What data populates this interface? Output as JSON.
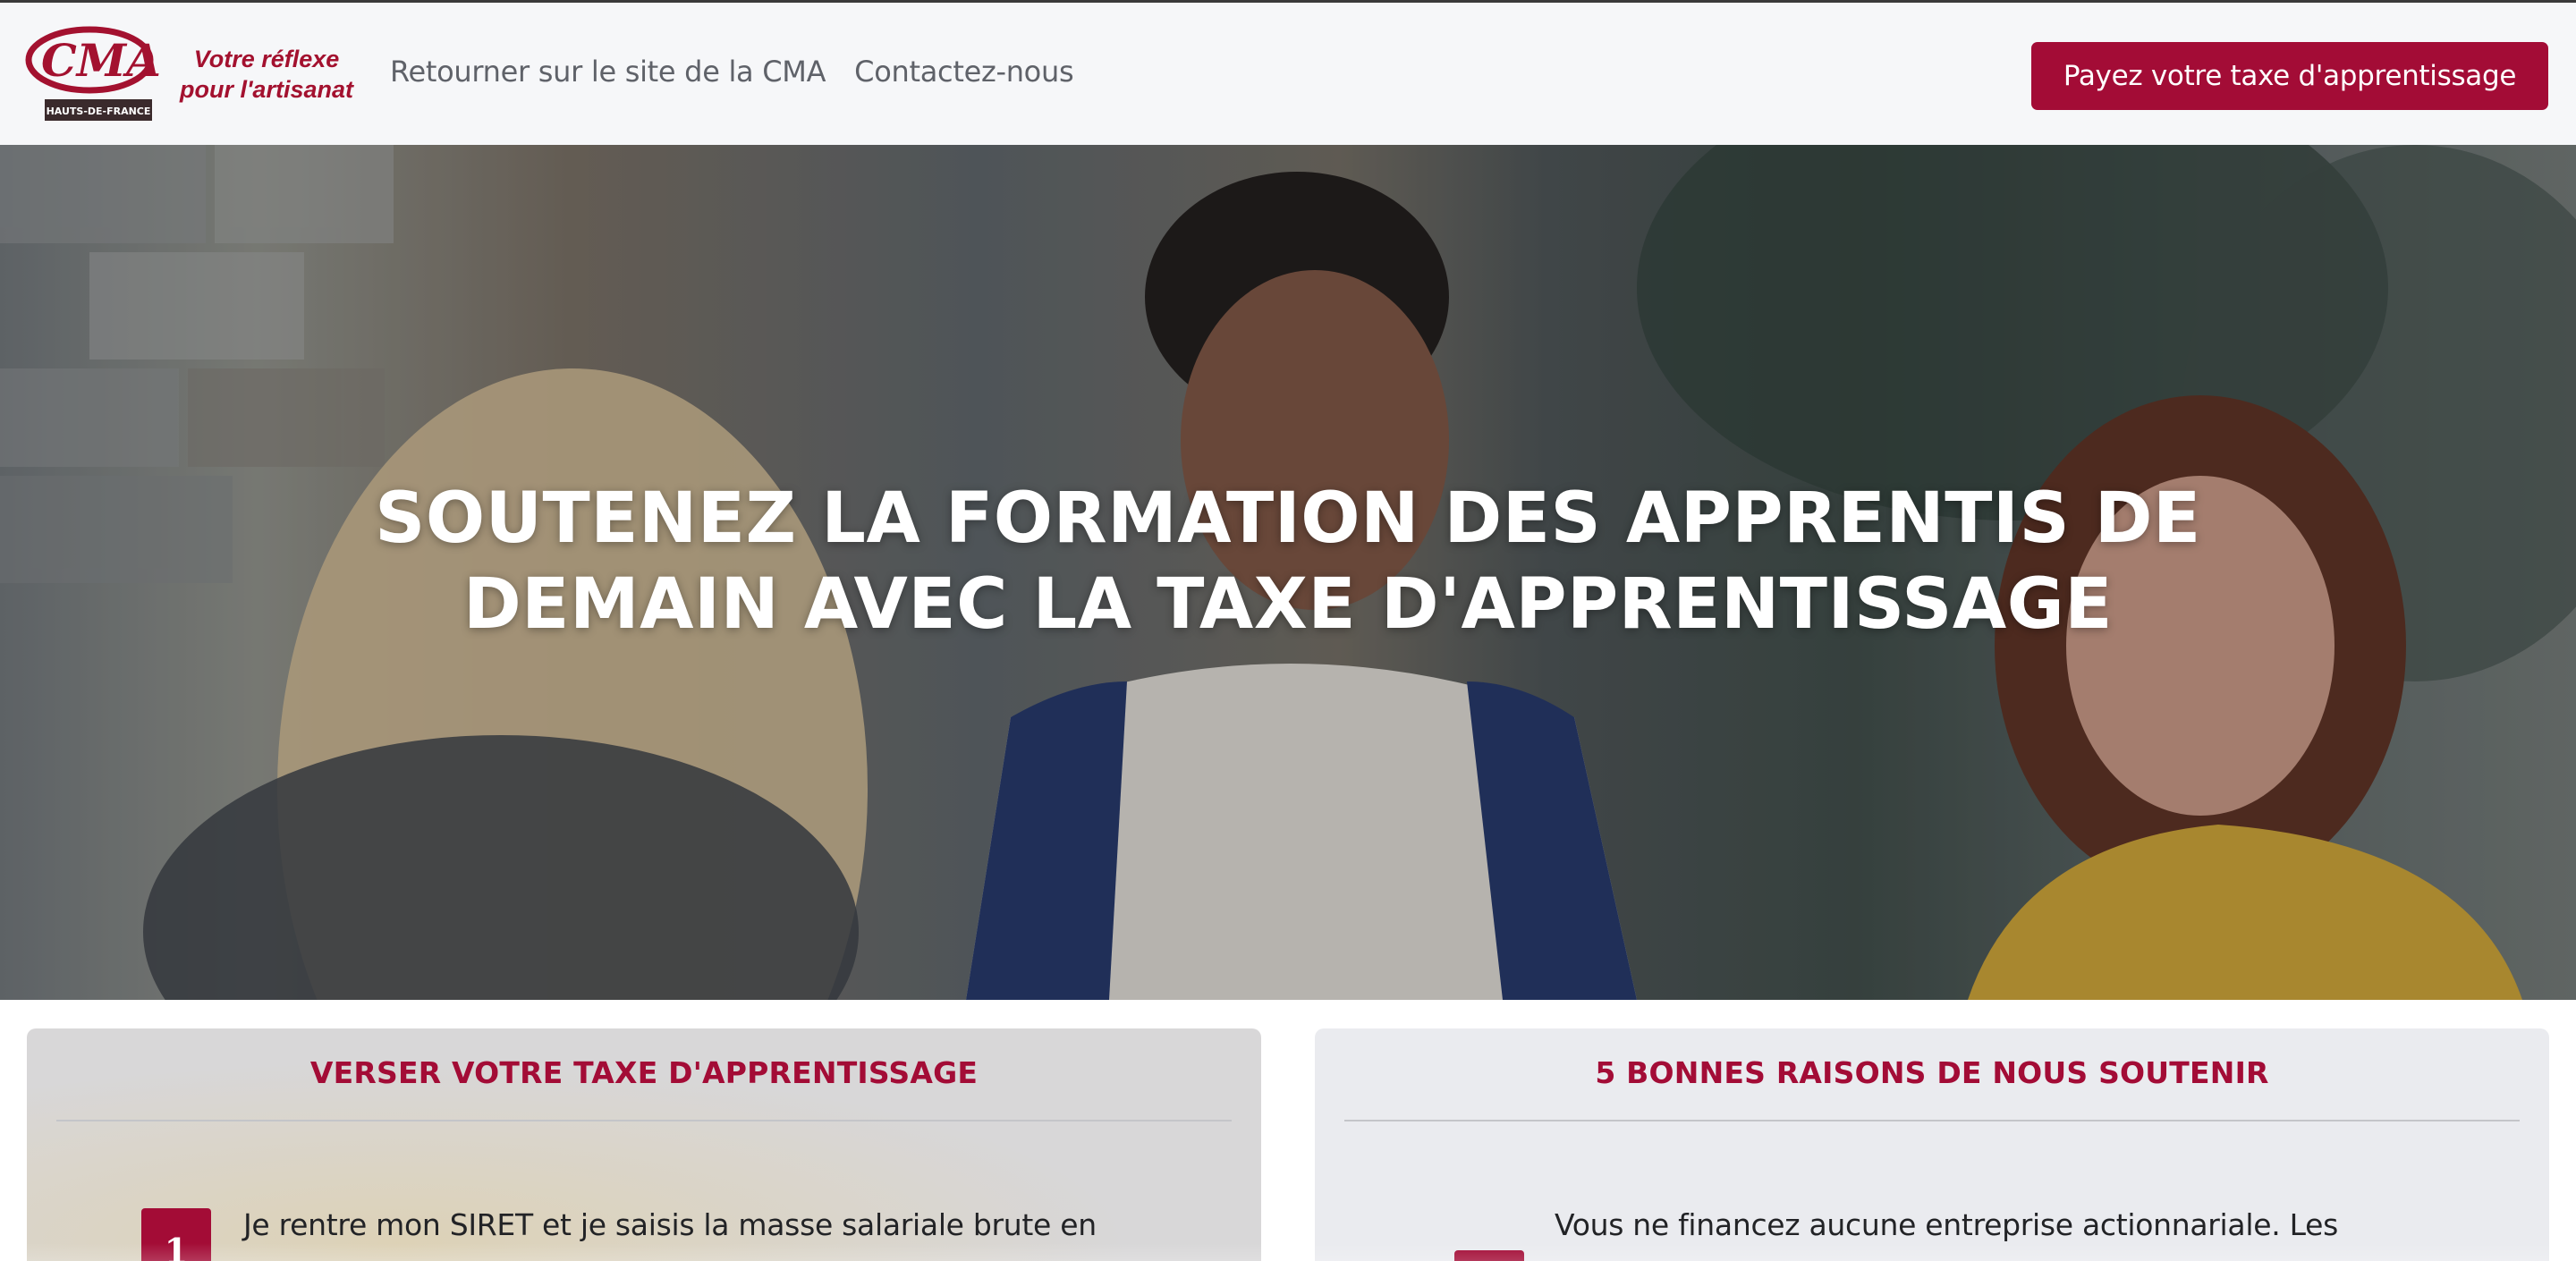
{
  "header": {
    "logo_text": "CMA",
    "logo_region": "HAUTS-DE-FRANCE",
    "tagline_line1": "Votre réflexe",
    "tagline_line2": "pour l'artisanat",
    "nav": [
      {
        "label": "Retourner sur le site de la CMA"
      },
      {
        "label": "Contactez-nous"
      }
    ],
    "cta_label": "Payez votre taxe d'apprentissage"
  },
  "hero": {
    "title": "SOUTENEZ LA FORMATION DES APPRENTIS DE DEMAIN AVEC LA TAXE D'APPRENTISSAGE"
  },
  "cards": {
    "left": {
      "title": "VERSER VOTRE TAXE D'APPRENTISSAGE",
      "step_number": "1",
      "step_text": "Je rentre mon SIRET et je saisis la masse salariale brute en"
    },
    "right": {
      "title": "5 BONNES RAISONS DE NOUS SOUTENIR",
      "reason_text": "Vous ne financez aucune entreprise actionnariale. Les"
    }
  },
  "colors": {
    "brand": "#a30c36",
    "header_bg": "#f6f7f9",
    "nav_text": "#5f6269"
  }
}
